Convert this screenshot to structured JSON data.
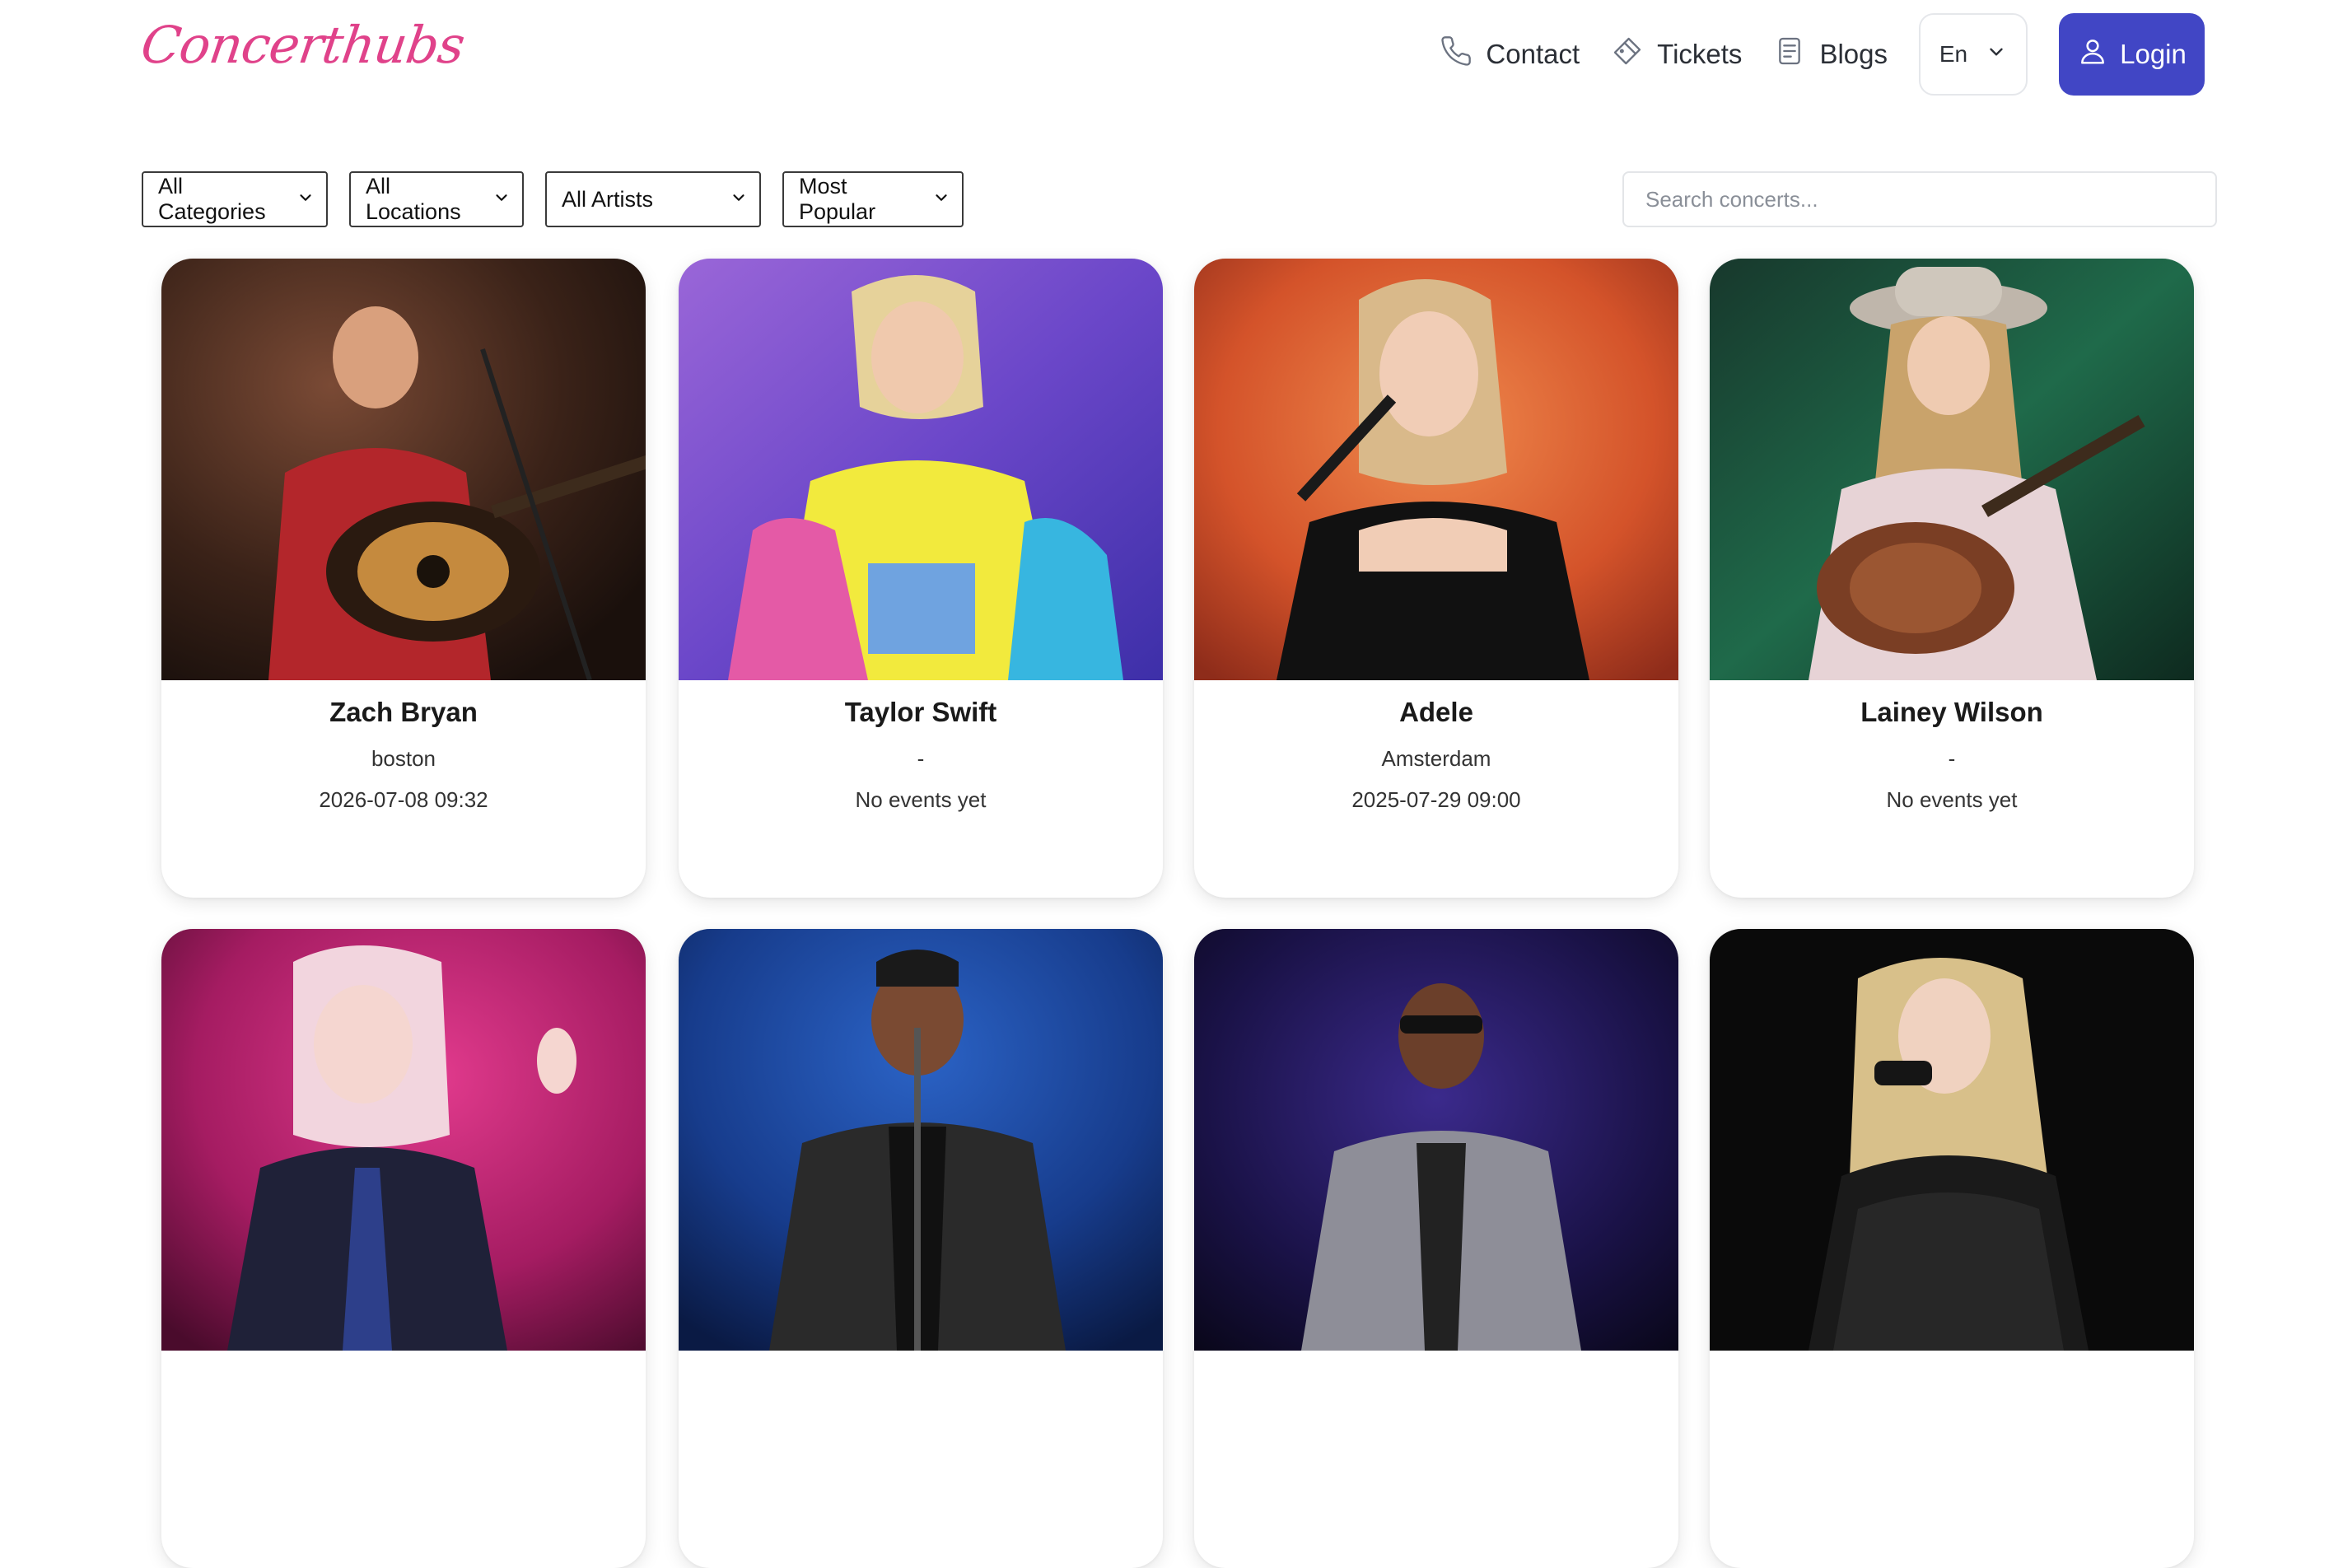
{
  "brand": {
    "logo_text": "Concerthubs",
    "accent": "#e0428a",
    "primary": "#4146c5"
  },
  "nav": {
    "contact": {
      "label": "Contact",
      "icon": "phone-icon"
    },
    "tickets": {
      "label": "Tickets",
      "icon": "ticket-icon"
    },
    "blogs": {
      "label": "Blogs",
      "icon": "document-icon"
    },
    "language": {
      "label": "En",
      "icon": "chevron-down-icon"
    },
    "login": {
      "label": "Login",
      "icon": "user-icon"
    }
  },
  "filters": {
    "category": "All Categories",
    "location": "All Locations",
    "artist": "All Artists",
    "sort": "Most Popular",
    "search_placeholder": "Search concerts..."
  },
  "concerts": [
    {
      "name": "Zach Bryan",
      "location": "boston",
      "date": "2026-07-08 09:32"
    },
    {
      "name": "Taylor Swift",
      "location": "-",
      "date": "No events yet"
    },
    {
      "name": "Adele",
      "location": "Amsterdam",
      "date": "2025-07-29 09:00"
    },
    {
      "name": "Lainey Wilson",
      "location": "-",
      "date": "No events yet"
    },
    {
      "name": "",
      "location": "",
      "date": ""
    },
    {
      "name": "",
      "location": "",
      "date": ""
    },
    {
      "name": "",
      "location": "",
      "date": ""
    },
    {
      "name": "",
      "location": "",
      "date": ""
    }
  ]
}
